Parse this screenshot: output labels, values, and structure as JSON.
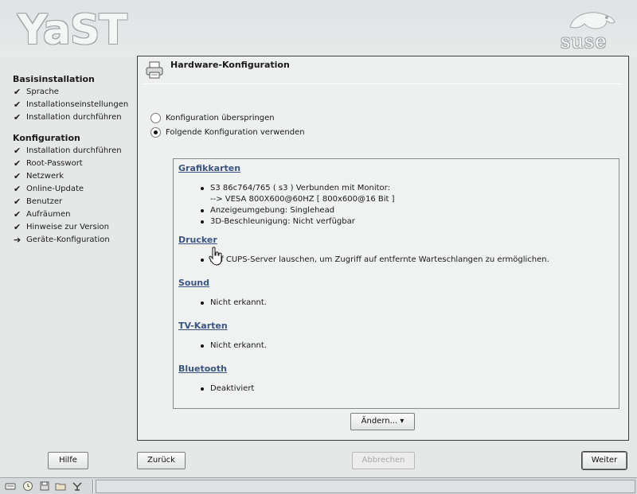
{
  "header": {
    "logo_text": "YaST",
    "brand_text": "suse"
  },
  "sidebar": {
    "groups": [
      {
        "heading": "Basisinstallation",
        "items": [
          {
            "label": "Sprache",
            "state": "done"
          },
          {
            "label": "Installationseinstellungen",
            "state": "done"
          },
          {
            "label": "Installation durchführen",
            "state": "done"
          }
        ]
      },
      {
        "heading": "Konfiguration",
        "items": [
          {
            "label": "Installation durchführen",
            "state": "done"
          },
          {
            "label": "Root-Passwort",
            "state": "done"
          },
          {
            "label": "Netzwerk",
            "state": "done"
          },
          {
            "label": "Online-Update",
            "state": "done"
          },
          {
            "label": "Benutzer",
            "state": "done"
          },
          {
            "label": "Aufräumen",
            "state": "done"
          },
          {
            "label": "Hinweise zur Version",
            "state": "done"
          },
          {
            "label": "Geräte-Konfiguration",
            "state": "current"
          }
        ]
      }
    ]
  },
  "main": {
    "title": "Hardware-Konfiguration",
    "radio_skip": "Konfiguration überspringen",
    "radio_use": "Folgende Konfiguration verwenden",
    "selected_option": "use",
    "sections": [
      {
        "heading": "Grafikkarten",
        "lines": [
          {
            "text": "S3 86c764/765 ( s3 ) Verbunden mit Monitor:",
            "bullet": true
          },
          {
            "text": "--> VESA 800X600@60HZ [ 800x600@16 Bit ]",
            "bullet": false
          },
          {
            "text": "Anzeigeumgebung: Singlehead",
            "bullet": true
          },
          {
            "text": "3D-Beschleunigung: Nicht verfügbar",
            "bullet": true
          }
        ]
      },
      {
        "heading": "Drucker",
        "lines": [
          {
            "text": "Auf CUPS-Server lauschen, um Zugriff auf entfernte Warteschlangen zu ermöglichen.",
            "bullet": true
          }
        ]
      },
      {
        "heading": "Sound",
        "lines": [
          {
            "text": "Nicht erkannt.",
            "bullet": true
          }
        ]
      },
      {
        "heading": "TV-Karten",
        "lines": [
          {
            "text": "Nicht erkannt.",
            "bullet": true
          }
        ]
      },
      {
        "heading": "Bluetooth",
        "lines": [
          {
            "text": "Deaktiviert",
            "bullet": true
          }
        ]
      }
    ],
    "change_button": "Ändern... ▾"
  },
  "footer": {
    "help": "Hilfe",
    "back": "Zurück",
    "abort": "Abbrechen",
    "next": "Weiter"
  },
  "taskbar": {
    "icons": [
      "keyboard-icon",
      "clock-icon",
      "floppy-icon",
      "folder-icon",
      "network-icon"
    ]
  }
}
